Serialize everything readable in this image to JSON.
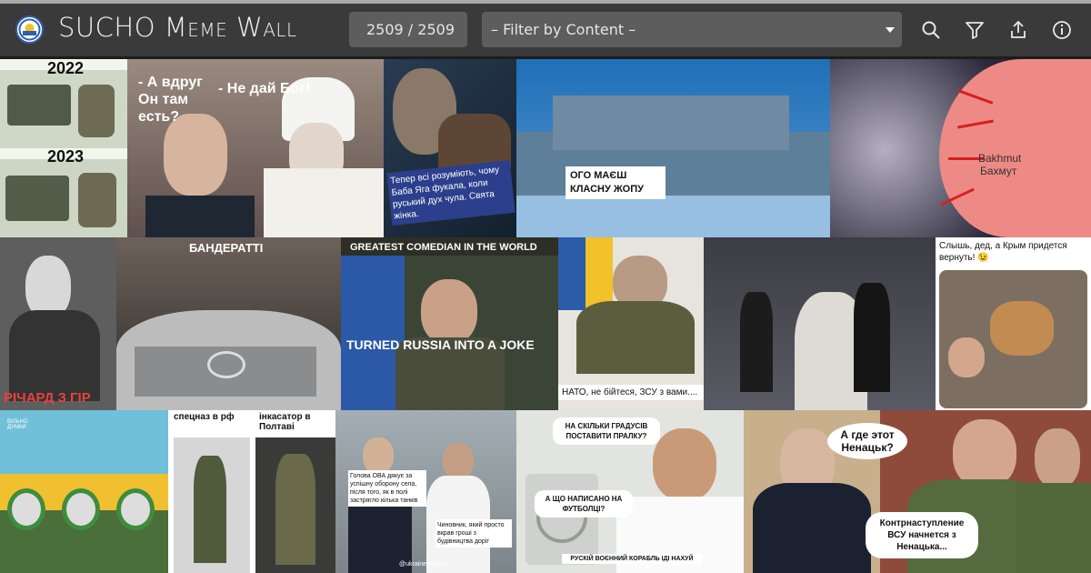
{
  "app": {
    "title_main": "SUCHO",
    "title_rest": "Meme Wall"
  },
  "header": {
    "counter": "2509 / 2509",
    "filter_placeholder": "– Filter by Content –",
    "icons": [
      "search-icon",
      "filter-icon",
      "share-icon",
      "info-icon"
    ]
  },
  "colors": {
    "header_bg": "#3a3a3a",
    "control_bg": "#5d5d5d",
    "page_bg": "#1c1c1c"
  },
  "memes": [
    {
      "id": "tile-2022-2023",
      "texts": [
        "2022",
        "2023"
      ]
    },
    {
      "id": "tile-putin-patriarch",
      "texts": [
        "- А вдруг Он там есть?",
        "- Не дай Бог!"
      ]
    },
    {
      "id": "tile-baba-yaga",
      "texts": [
        "Тепер всі розуміють, чому Баба Яга фукала, коли руський дух чула. Свята жінка."
      ]
    },
    {
      "id": "tile-warship",
      "texts": [
        "ОГО МАЄШ КЛАСНУ ЖОПУ"
      ]
    },
    {
      "id": "tile-bakhmut-galaxy",
      "texts": [
        "Bakhmut",
        "Бахмут"
      ]
    },
    {
      "id": "tile-richard",
      "texts": [
        "РІЧАРД З ГІР"
      ]
    },
    {
      "id": "tile-banderatti",
      "texts": [
        "БАНДЕРАТТІ"
      ]
    },
    {
      "id": "tile-zelensky-comedian",
      "texts": [
        "GREATEST COMEDIAN IN THE WORLD",
        "TURNED RUSSIA INTO A JOKE"
      ]
    },
    {
      "id": "tile-zaluzhnyi",
      "texts": [
        "НАТО, не бійтеся, ЗСУ з вами...."
      ]
    },
    {
      "id": "tile-wedding",
      "texts": []
    },
    {
      "id": "tile-patron-crimea",
      "texts": [
        "Слышь, дед, а Крым придется вернуть! 😉"
      ]
    },
    {
      "id": "tile-sunflowers",
      "texts": [
        "ВІЛЬНО ДУМКИ"
      ]
    },
    {
      "id": "tile-spetsnaz",
      "texts": [
        "спецназ в рф",
        "інкасатор в Полтаві"
      ]
    },
    {
      "id": "tile-handshake",
      "texts": [
        "Голова ОВА дякує за успішну оборону села, після того, як в полі застрягло кілька танків",
        "Чиновник, який просто вкрав гроші з будівництва доріг",
        "@ukrainememes"
      ]
    },
    {
      "id": "tile-washing-machine",
      "texts": [
        "НА СКІЛЬКИ ГРАДУСІВ ПОСТАВИТИ ПРАЛКУ?",
        "А ЩО НАПИСАНО НА ФУТБОЛЦІ?",
        "РУСКІЙ ВОЄННИЙ КОРАБЛЬ ІДІ НАХУЙ"
      ]
    },
    {
      "id": "tile-putin-shoigu",
      "texts": [
        "А где этот Ненацьк?",
        "Контрнаступление ВСУ начнется з Ненацька..."
      ]
    }
  ]
}
